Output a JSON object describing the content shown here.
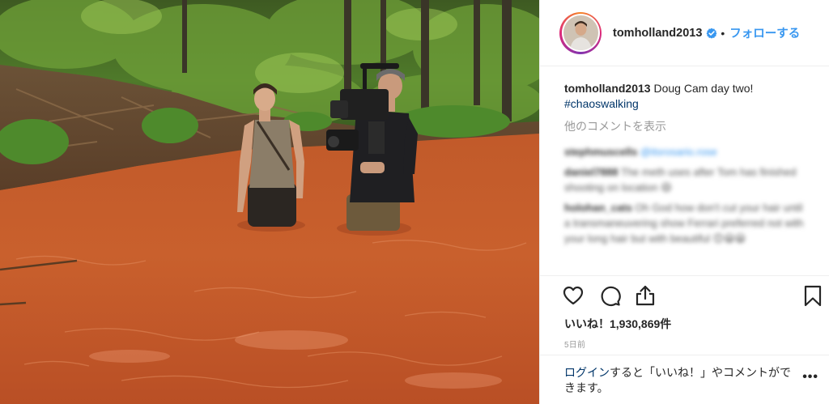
{
  "post": {
    "username": "tomholland2013",
    "follow_label": "フォローする",
    "separator": "•",
    "caption_text": "Doug Cam day two!",
    "hashtag": "#chaoswalking",
    "view_more_comments": "他のコメントを表示",
    "blurred_comments": [
      {
        "user": "stephmuscells",
        "text": "@itsrosario.rose"
      },
      {
        "user": "daniel7888",
        "text": "The meth uses after Tom has finished shooting on location 😄"
      },
      {
        "user": "holohan_cats",
        "text": "Oh God how don't cut your hair until a transmaneuvering show Ferrari preferred not with your long hair but with beautiful 😊😀😀"
      }
    ],
    "likes_label": "いいね！",
    "likes_count": "1,930,869件",
    "timestamp": "5日前",
    "login_link": "ログイン",
    "login_text": "すると「いいね！」やコメントができます。",
    "more_options": "•••"
  },
  "icons": {
    "verified": "verified-badge-icon",
    "like": "heart-icon",
    "comment": "comment-bubble-icon",
    "share": "share-icon",
    "save": "bookmark-icon"
  },
  "colors": {
    "link_blue": "#3897f0",
    "hashtag_navy": "#003569",
    "muted_gray": "#999999",
    "text_dark": "#262626"
  }
}
